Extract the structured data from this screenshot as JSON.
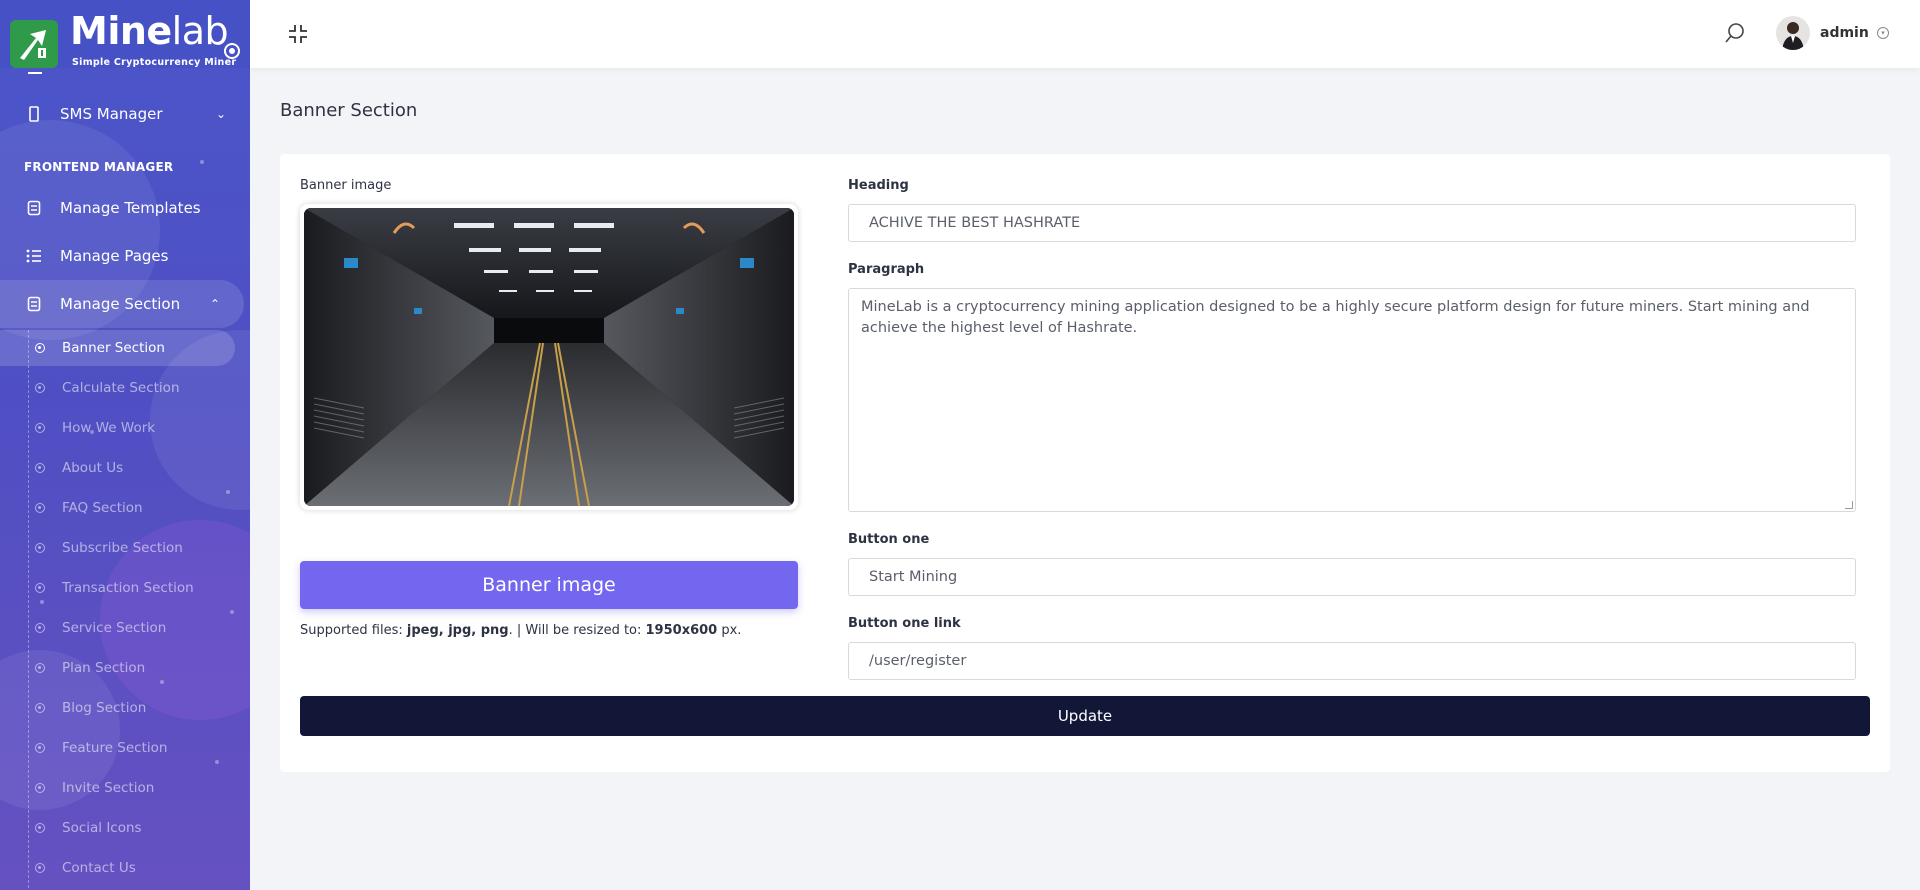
{
  "brand": {
    "name_main": "Mine",
    "name_accent": "lab",
    "tagline": "Simple Cryptocurrency Miner",
    "mark_color": "#2f9a4a"
  },
  "sidebar": {
    "sms_manager": "SMS Manager",
    "frontend_title": "FRONTEND MANAGER",
    "items": [
      {
        "label": "Manage Templates",
        "icon": "template-icon"
      },
      {
        "label": "Manage Pages",
        "icon": "list-icon"
      },
      {
        "label": "Manage Section",
        "icon": "section-icon"
      }
    ],
    "sections": [
      "Banner Section",
      "Calculate Section",
      "How We Work",
      "About Us",
      "FAQ Section",
      "Subscribe Section",
      "Transaction Section",
      "Service Section",
      "Plan Section",
      "Blog Section",
      "Feature Section",
      "Invite Section",
      "Social Icons",
      "Contact Us"
    ],
    "active_section": "Banner Section"
  },
  "header": {
    "user_name": "admin"
  },
  "page": {
    "title": "Banner Section"
  },
  "form": {
    "banner_image_label": "Banner image",
    "upload_button": "Banner image",
    "hint_prefix": "Supported files: ",
    "hint_types": "jpeg, jpg, png",
    "hint_middle": ". | Will be resized to: ",
    "hint_size": "1950x600",
    "hint_suffix": " px.",
    "heading_label": "Heading",
    "heading_value": "ACHIVE THE BEST HASHRATE",
    "paragraph_label": "Paragraph",
    "paragraph_value": "MineLab is a cryptocurrency mining application designed to be a highly secure platform design for future miners. Start mining and achieve the highest level of Hashrate.",
    "button_one_label": "Button one",
    "button_one_value": "Start Mining",
    "button_one_link_label": "Button one link",
    "button_one_link_value": "/user/register",
    "submit": "Update"
  },
  "colors": {
    "sidebar_top": "#4a56c9",
    "sidebar_bottom": "#6651c1",
    "primary_button": "#7367f0",
    "update_button": "#121738"
  }
}
